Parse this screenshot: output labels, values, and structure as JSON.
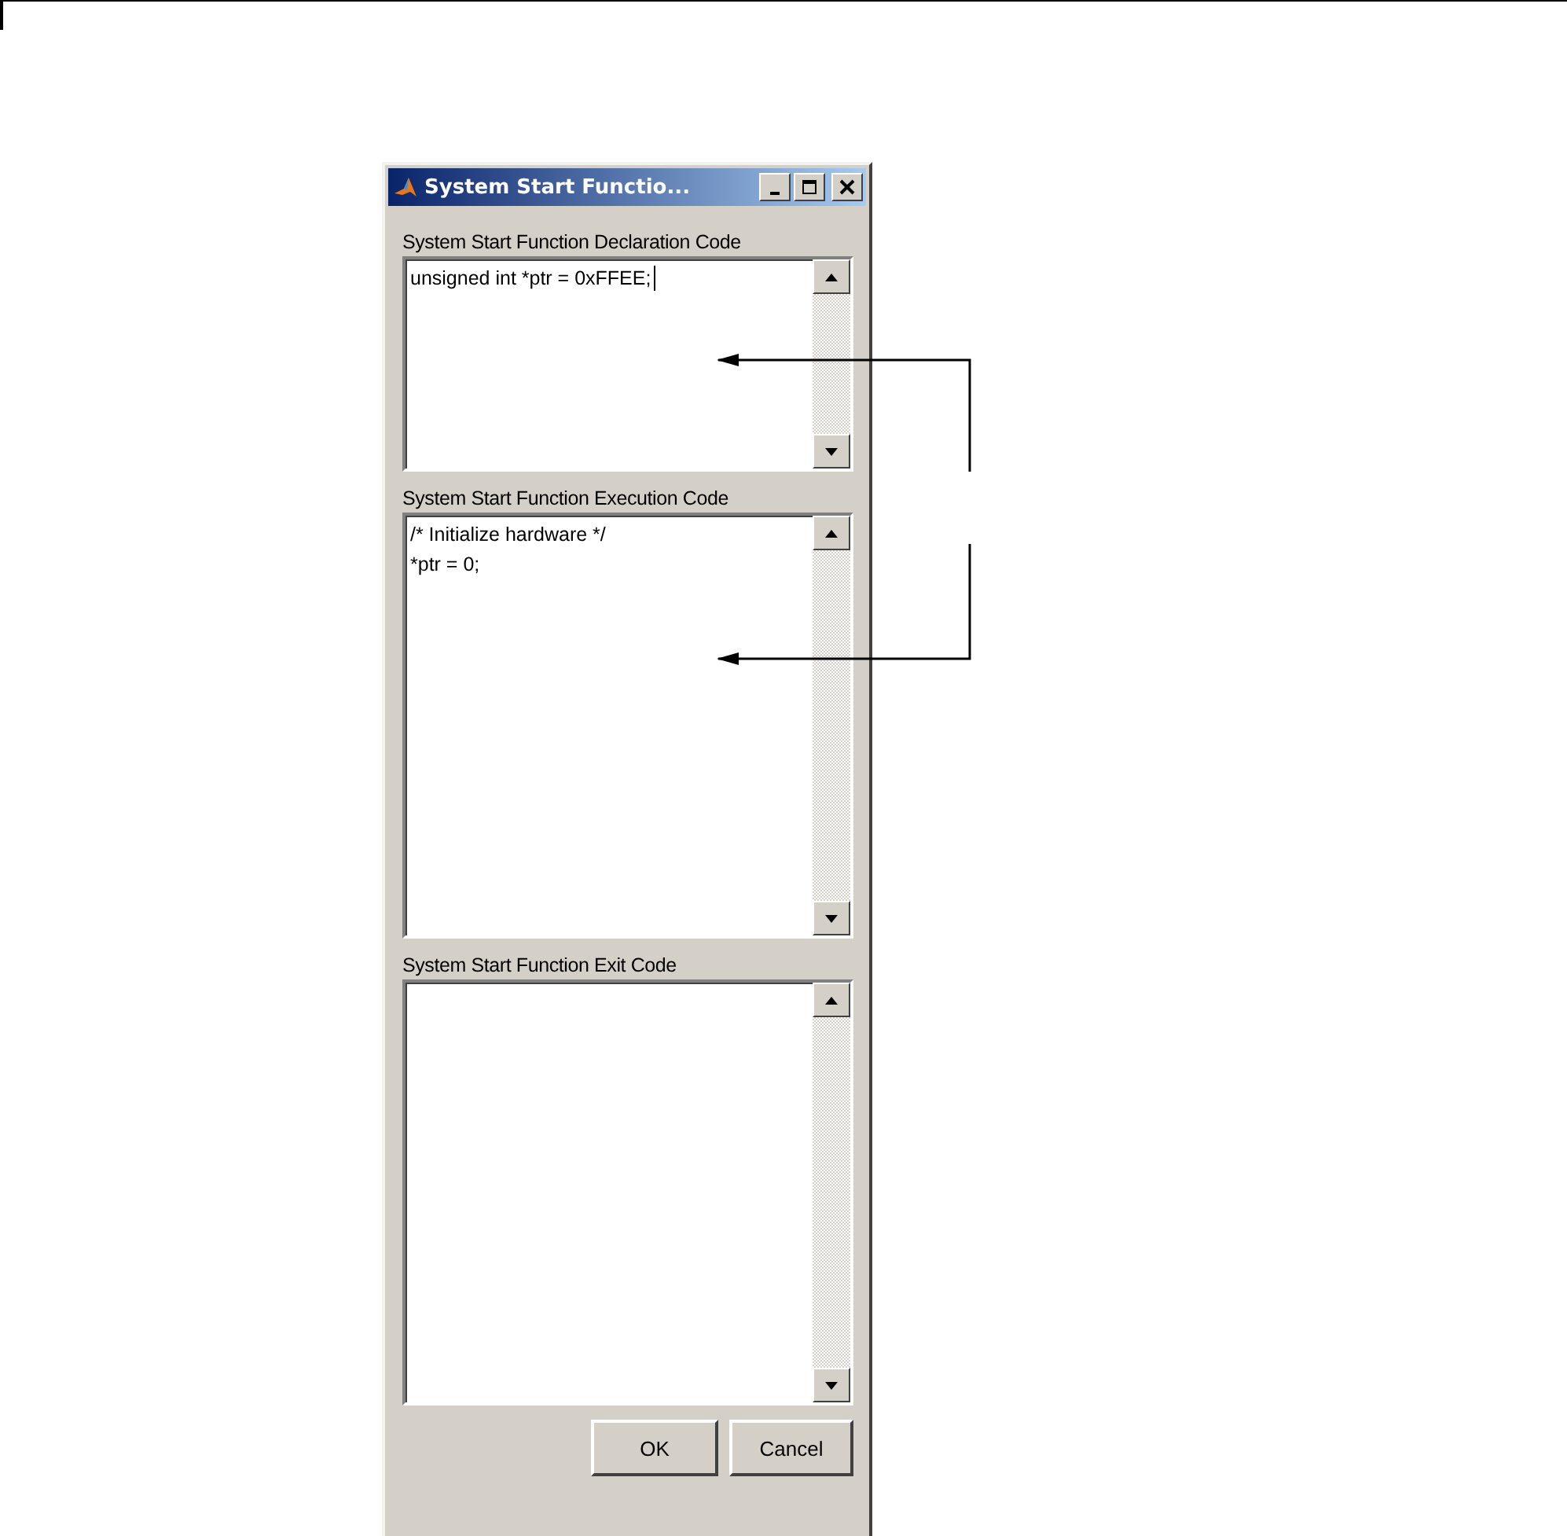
{
  "window": {
    "title": "System Start Functio..."
  },
  "fields": [
    {
      "label": "System Start Function Declaration Code",
      "lines": [
        "unsigned int *ptr = 0xFFEE;"
      ],
      "focused": true
    },
    {
      "label": "System Start Function Execution Code",
      "lines": [
        "/* Initialize hardware */",
        "*ptr = 0;"
      ],
      "focused": false
    },
    {
      "label": "System Start Function Exit Code",
      "focused": false
    }
  ],
  "buttons": [
    "OK",
    "Cancel"
  ]
}
